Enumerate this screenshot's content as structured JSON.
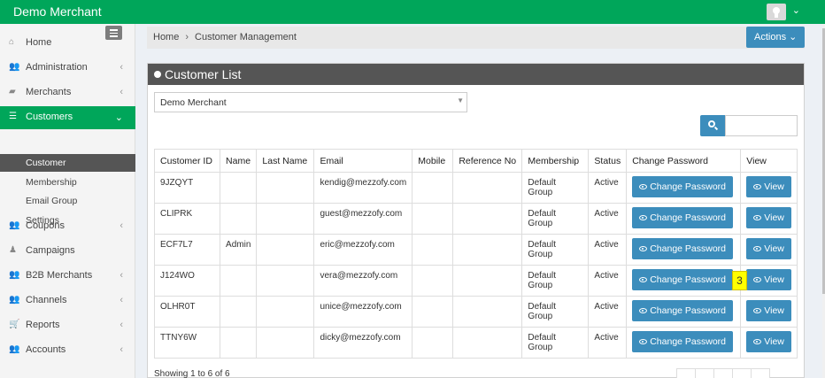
{
  "app": {
    "title": "Demo Merchant"
  },
  "sidebar": {
    "items": [
      {
        "label": "Home",
        "icon": "home-icon",
        "glyph": "⌂",
        "arrow": ""
      },
      {
        "label": "Administration",
        "icon": "users-icon",
        "glyph": "👥",
        "arrow": "‹"
      },
      {
        "label": "Merchants",
        "icon": "briefcase-icon",
        "glyph": "▰",
        "arrow": "‹"
      },
      {
        "label": "Customers",
        "icon": "list-icon",
        "glyph": "☰",
        "arrow": "⌄",
        "active": true
      },
      {
        "label": "Coupons",
        "icon": "users-icon",
        "glyph": "👥",
        "arrow": "‹"
      },
      {
        "label": "Campaigns",
        "icon": "user-icon",
        "glyph": "♟",
        "arrow": ""
      },
      {
        "label": "B2B Merchants",
        "icon": "users-icon",
        "glyph": "👥",
        "arrow": "‹"
      },
      {
        "label": "Channels",
        "icon": "users-icon",
        "glyph": "👥",
        "arrow": "‹"
      },
      {
        "label": "Reports",
        "icon": "cart-icon",
        "glyph": "🛒",
        "arrow": "‹"
      },
      {
        "label": "Accounts",
        "icon": "users-icon",
        "glyph": "👥",
        "arrow": "‹"
      }
    ],
    "subitems": [
      {
        "label": "Customer",
        "active": true
      },
      {
        "label": "Membership"
      },
      {
        "label": "Email Group"
      },
      {
        "label": "Settings"
      }
    ]
  },
  "breadcrumb": {
    "home": "Home",
    "separator": "›",
    "current": "Customer Management"
  },
  "actions_label": "Actions ⌄",
  "panel": {
    "title": "Customer List",
    "merchant_select": "Demo Merchant",
    "search_placeholder": ""
  },
  "table": {
    "headers": [
      "Customer ID",
      "Name",
      "Last Name",
      "Email",
      "Mobile",
      "Reference No",
      "Membership",
      "Status",
      "Change Password",
      "View"
    ],
    "rows": [
      {
        "id": "9JZQYT",
        "name": "",
        "last": "",
        "email": "kendig@mezzofy.com",
        "mobile": "",
        "ref": "",
        "membership": "Default Group",
        "status": "Active"
      },
      {
        "id": "CLIPRK",
        "name": "",
        "last": "",
        "email": "guest@mezzofy.com",
        "mobile": "",
        "ref": "",
        "membership": "Default Group",
        "status": "Active"
      },
      {
        "id": "ECF7L7",
        "name": "Admin",
        "last": "",
        "email": "eric@mezzofy.com",
        "mobile": "",
        "ref": "",
        "membership": "Default Group",
        "status": "Active"
      },
      {
        "id": "J124WO",
        "name": "",
        "last": "",
        "email": "vera@mezzofy.com",
        "mobile": "",
        "ref": "",
        "membership": "Default Group",
        "status": "Active"
      },
      {
        "id": "OLHR0T",
        "name": "",
        "last": "",
        "email": "unice@mezzofy.com",
        "mobile": "",
        "ref": "",
        "membership": "Default Group",
        "status": "Active"
      },
      {
        "id": "TTNY6W",
        "name": "",
        "last": "",
        "email": "dicky@mezzofy.com",
        "mobile": "",
        "ref": "",
        "membership": "Default Group",
        "status": "Active"
      }
    ],
    "change_password_label": "Change Password",
    "view_label": "View"
  },
  "annotation_marker": "3",
  "footer": {
    "showing": "Showing 1 to 6 of 6"
  },
  "colors": {
    "brand_green": "#00a65a",
    "primary_blue": "#3c8dbc",
    "panel_header": "#555555",
    "marker_yellow": "#ffff00"
  }
}
